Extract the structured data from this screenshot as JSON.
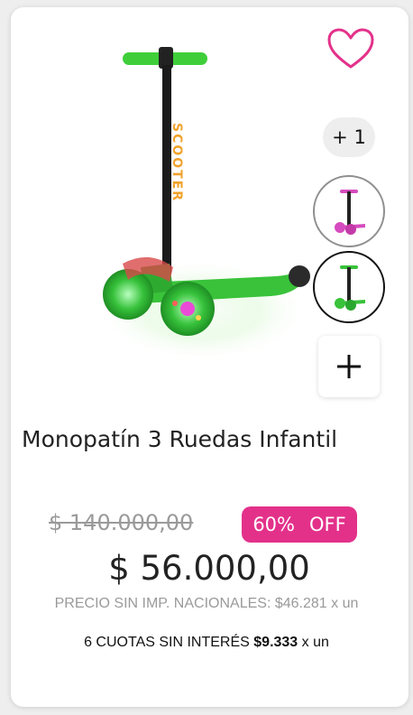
{
  "product": {
    "title": "Monopatín 3 Ruedas Infantil",
    "image_text": "SCOOTER"
  },
  "gallery": {
    "more_count": "+ 1"
  },
  "pricing": {
    "old_price": "$ 140.000,00",
    "discount_pct": "60%",
    "discount_off": "OFF",
    "price": "$ 56.000,00",
    "tax_note": "PRECIO SIN IMP. NACIONALES: $46.281 x un",
    "installments_prefix": "6 CUOTAS SIN INTERÉS",
    "installments_amount": "$9.333",
    "installments_suffix": "x un"
  },
  "colors": {
    "accent": "#e3318a",
    "scooter_green": "#39c23a",
    "thumb_pink": "#d64bbf"
  },
  "icons": {
    "favorite": "heart-outline-icon",
    "add": "plus-icon"
  }
}
